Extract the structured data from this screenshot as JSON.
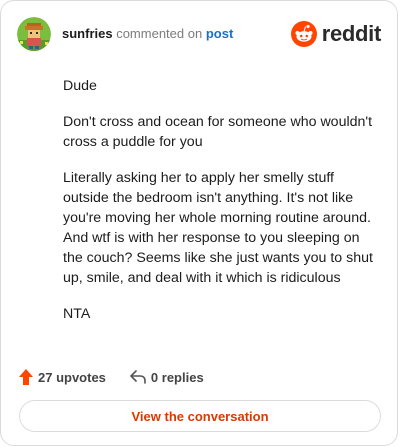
{
  "header": {
    "username": "sunfries",
    "action_text": "commented on",
    "target_text": "post",
    "brand_name": "reddit",
    "brand_color": "#ff4500"
  },
  "comment": {
    "paragraphs": [
      "Dude",
      "Don't cross and ocean for someone who wouldn't cross a puddle for you",
      "Literally asking her to apply her smelly stuff outside the bedroom isn't anything. It's not like you're moving her whole morning routine around. And wtf is with her response to you sleeping on the couch? Seems like she just wants you to shut up, smile, and deal with it which is ridiculous",
      "NTA"
    ]
  },
  "stats": {
    "upvotes_label": "27 upvotes",
    "replies_label": "0 replies",
    "upvote_icon": "upvote-arrow-icon",
    "reply_icon": "reply-arrow-icon",
    "upvote_color": "#ff4500"
  },
  "cta": {
    "label": "View the conversation",
    "color": "#d93a00"
  }
}
